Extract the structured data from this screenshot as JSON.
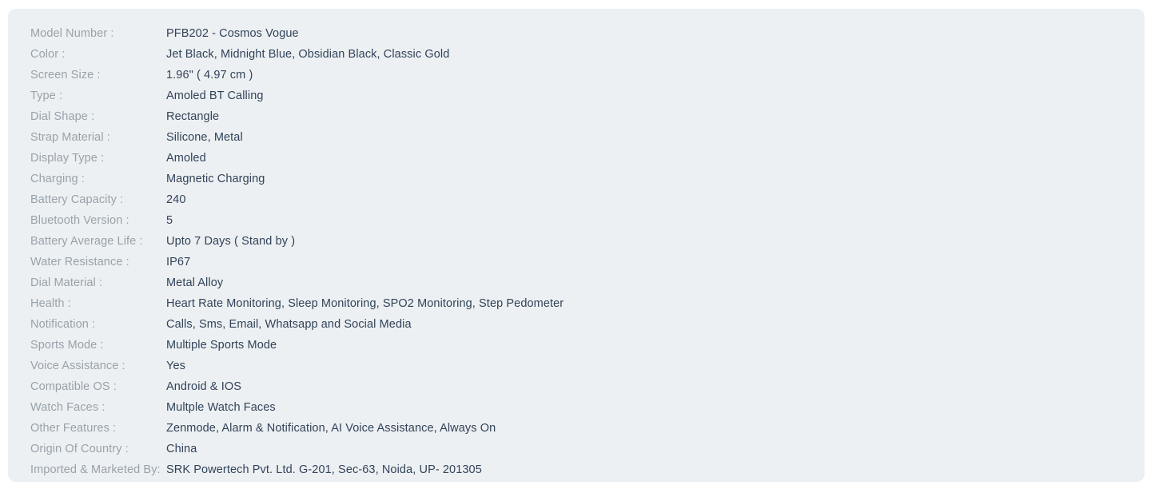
{
  "panel": {
    "background_color": "#edf0f2",
    "page_background_color": "#ffffff",
    "label_color": "#98a2ab",
    "value_color": "#31435a"
  },
  "specs": [
    {
      "label": "Model Number :",
      "value": "PFB202 - Cosmos Vogue"
    },
    {
      "label": "Color :",
      "value": "Jet Black, Midnight Blue, Obsidian Black, Classic Gold"
    },
    {
      "label": "Screen Size :",
      "value": "1.96\" ( 4.97 cm )"
    },
    {
      "label": "Type :",
      "value": "Amoled BT Calling"
    },
    {
      "label": "Dial Shape :",
      "value": "Rectangle"
    },
    {
      "label": "Strap Material :",
      "value": "Silicone, Metal"
    },
    {
      "label": "Display Type :",
      "value": "Amoled"
    },
    {
      "label": "Charging :",
      "value": "Magnetic Charging"
    },
    {
      "label": "Battery Capacity :",
      "value": "240"
    },
    {
      "label": "Bluetooth Version :",
      "value": "5"
    },
    {
      "label": "Battery Average Life :",
      "value": "Upto 7 Days ( Stand by )"
    },
    {
      "label": "Water Resistance :",
      "value": "IP67"
    },
    {
      "label": "Dial Material :",
      "value": "Metal Alloy"
    },
    {
      "label": "Health :",
      "value": "Heart Rate Monitoring, Sleep Monitoring, SPO2 Monitoring, Step Pedometer"
    },
    {
      "label": "Notification :",
      "value": "Calls, Sms, Email, Whatsapp and Social Media"
    },
    {
      "label": "Sports Mode :",
      "value": "Multiple Sports Mode"
    },
    {
      "label": "Voice Assistance :",
      "value": "Yes"
    },
    {
      "label": "Compatible OS :",
      "value": "Android & IOS"
    },
    {
      "label": "Watch Faces :",
      "value": "Multple Watch Faces"
    },
    {
      "label": "Other Features :",
      "value": "Zenmode, Alarm & Notification, AI Voice Assistance, Always On"
    },
    {
      "label": "Origin Of Country :",
      "value": "China"
    },
    {
      "label": "Imported & Marketed By:",
      "value": "SRK Powertech Pvt. Ltd. G-201, Sec-63, Noida, UP- 201305"
    }
  ]
}
